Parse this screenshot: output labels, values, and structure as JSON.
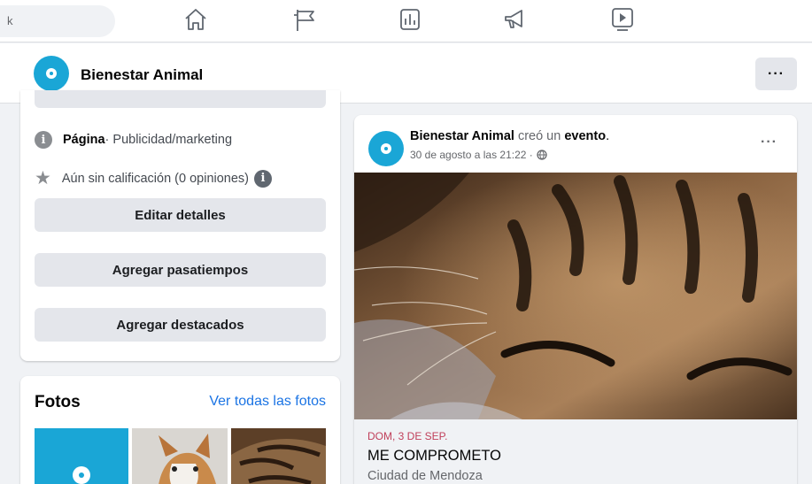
{
  "nav": {
    "search_chevron": "k",
    "icons": [
      "home-icon",
      "flag-icon",
      "insights-icon",
      "megaphone-icon",
      "video-icon"
    ]
  },
  "header": {
    "page_name": "Bienestar Animal",
    "more_label": "···"
  },
  "intro": {
    "category_label": "Página",
    "category_value": " · Publicidad/marketing",
    "rating_text": "Aún sin calificación (0 opiniones)",
    "info_glyph": "i",
    "buttons": {
      "edit_details": "Editar detalles",
      "add_hobbies": "Agregar pasatiempos",
      "add_featured": "Agregar destacados"
    }
  },
  "photos": {
    "title": "Fotos",
    "see_all": "Ver todas las fotos"
  },
  "post": {
    "author": "Bienestar Animal",
    "action": " creó un ",
    "object": "evento",
    "period": ".",
    "timestamp": "30 de agosto a las 21:22 · ",
    "more_label": "···",
    "event": {
      "date": "DOM, 3 DE SEP.",
      "title": "ME COMPROMETO",
      "location": "Ciudad de Mendoza"
    }
  },
  "colors": {
    "brand_blue": "#1aa6d6",
    "link_blue": "#1b74e4",
    "date_red": "#c03f5a",
    "button_grey": "#e4e6eb"
  }
}
